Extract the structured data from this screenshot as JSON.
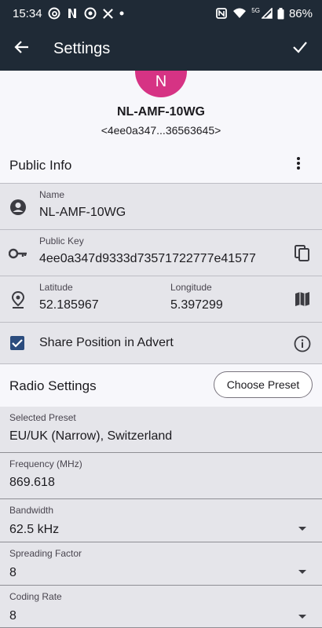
{
  "status_bar": {
    "time": "15:34",
    "network_label": "5G",
    "battery": "86%"
  },
  "app_bar": {
    "title": "Settings"
  },
  "profile": {
    "avatar_initial": "N",
    "name": "NL-AMF-10WG",
    "key_short": "<4ee0a347...36563645>"
  },
  "public_info": {
    "heading": "Public Info",
    "name": {
      "label": "Name",
      "value": "NL-AMF-10WG"
    },
    "public_key": {
      "label": "Public Key",
      "value": "4ee0a347d9333d73571722777e41577"
    },
    "latitude": {
      "label": "Latitude",
      "value": "52.185967"
    },
    "longitude": {
      "label": "Longitude",
      "value": "5.397299"
    },
    "share_position": {
      "label": "Share Position in Advert",
      "checked": true
    }
  },
  "radio_settings": {
    "heading": "Radio Settings",
    "choose_preset_label": "Choose Preset",
    "selected_preset": {
      "label": "Selected Preset",
      "value": "EU/UK (Narrow), Switzerland"
    },
    "frequency": {
      "label": "Frequency (MHz)",
      "value": "869.618"
    },
    "bandwidth": {
      "label": "Bandwidth",
      "value": "62.5 kHz"
    },
    "spreading_factor": {
      "label": "Spreading Factor",
      "value": "8"
    },
    "coding_rate": {
      "label": "Coding Rate",
      "value": "8"
    }
  },
  "colors": {
    "header_bg": "#1f2a36",
    "avatar_bg": "#d63384",
    "field_bg": "#e5e5ea",
    "checkbox": "#2b4c7e"
  }
}
